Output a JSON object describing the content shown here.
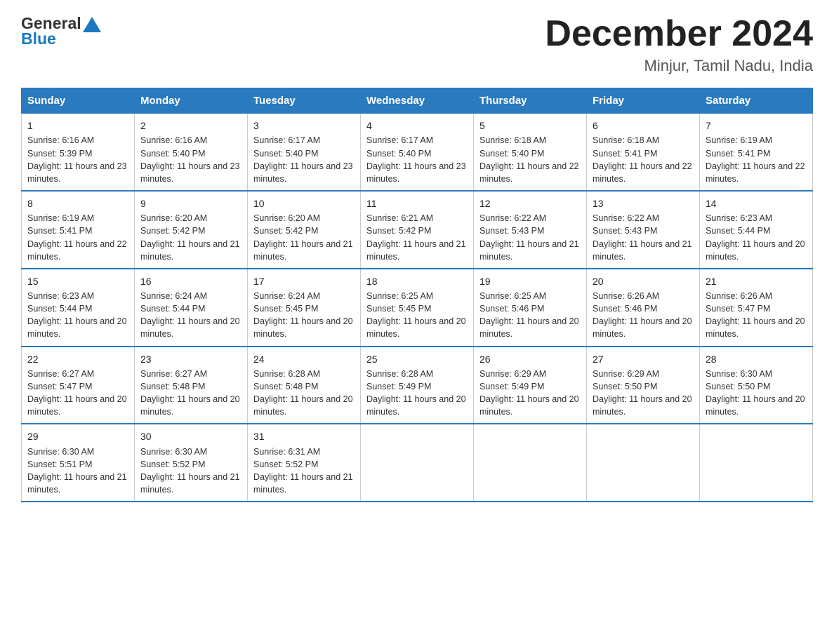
{
  "logo": {
    "text1": "General",
    "text2": "Blue"
  },
  "title": "December 2024",
  "location": "Minjur, Tamil Nadu, India",
  "days_of_week": [
    "Sunday",
    "Monday",
    "Tuesday",
    "Wednesday",
    "Thursday",
    "Friday",
    "Saturday"
  ],
  "weeks": [
    [
      {
        "day": "1",
        "sunrise": "6:16 AM",
        "sunset": "5:39 PM",
        "daylight": "11 hours and 23 minutes."
      },
      {
        "day": "2",
        "sunrise": "6:16 AM",
        "sunset": "5:40 PM",
        "daylight": "11 hours and 23 minutes."
      },
      {
        "day": "3",
        "sunrise": "6:17 AM",
        "sunset": "5:40 PM",
        "daylight": "11 hours and 23 minutes."
      },
      {
        "day": "4",
        "sunrise": "6:17 AM",
        "sunset": "5:40 PM",
        "daylight": "11 hours and 23 minutes."
      },
      {
        "day": "5",
        "sunrise": "6:18 AM",
        "sunset": "5:40 PM",
        "daylight": "11 hours and 22 minutes."
      },
      {
        "day": "6",
        "sunrise": "6:18 AM",
        "sunset": "5:41 PM",
        "daylight": "11 hours and 22 minutes."
      },
      {
        "day": "7",
        "sunrise": "6:19 AM",
        "sunset": "5:41 PM",
        "daylight": "11 hours and 22 minutes."
      }
    ],
    [
      {
        "day": "8",
        "sunrise": "6:19 AM",
        "sunset": "5:41 PM",
        "daylight": "11 hours and 22 minutes."
      },
      {
        "day": "9",
        "sunrise": "6:20 AM",
        "sunset": "5:42 PM",
        "daylight": "11 hours and 21 minutes."
      },
      {
        "day": "10",
        "sunrise": "6:20 AM",
        "sunset": "5:42 PM",
        "daylight": "11 hours and 21 minutes."
      },
      {
        "day": "11",
        "sunrise": "6:21 AM",
        "sunset": "5:42 PM",
        "daylight": "11 hours and 21 minutes."
      },
      {
        "day": "12",
        "sunrise": "6:22 AM",
        "sunset": "5:43 PM",
        "daylight": "11 hours and 21 minutes."
      },
      {
        "day": "13",
        "sunrise": "6:22 AM",
        "sunset": "5:43 PM",
        "daylight": "11 hours and 21 minutes."
      },
      {
        "day": "14",
        "sunrise": "6:23 AM",
        "sunset": "5:44 PM",
        "daylight": "11 hours and 20 minutes."
      }
    ],
    [
      {
        "day": "15",
        "sunrise": "6:23 AM",
        "sunset": "5:44 PM",
        "daylight": "11 hours and 20 minutes."
      },
      {
        "day": "16",
        "sunrise": "6:24 AM",
        "sunset": "5:44 PM",
        "daylight": "11 hours and 20 minutes."
      },
      {
        "day": "17",
        "sunrise": "6:24 AM",
        "sunset": "5:45 PM",
        "daylight": "11 hours and 20 minutes."
      },
      {
        "day": "18",
        "sunrise": "6:25 AM",
        "sunset": "5:45 PM",
        "daylight": "11 hours and 20 minutes."
      },
      {
        "day": "19",
        "sunrise": "6:25 AM",
        "sunset": "5:46 PM",
        "daylight": "11 hours and 20 minutes."
      },
      {
        "day": "20",
        "sunrise": "6:26 AM",
        "sunset": "5:46 PM",
        "daylight": "11 hours and 20 minutes."
      },
      {
        "day": "21",
        "sunrise": "6:26 AM",
        "sunset": "5:47 PM",
        "daylight": "11 hours and 20 minutes."
      }
    ],
    [
      {
        "day": "22",
        "sunrise": "6:27 AM",
        "sunset": "5:47 PM",
        "daylight": "11 hours and 20 minutes."
      },
      {
        "day": "23",
        "sunrise": "6:27 AM",
        "sunset": "5:48 PM",
        "daylight": "11 hours and 20 minutes."
      },
      {
        "day": "24",
        "sunrise": "6:28 AM",
        "sunset": "5:48 PM",
        "daylight": "11 hours and 20 minutes."
      },
      {
        "day": "25",
        "sunrise": "6:28 AM",
        "sunset": "5:49 PM",
        "daylight": "11 hours and 20 minutes."
      },
      {
        "day": "26",
        "sunrise": "6:29 AM",
        "sunset": "5:49 PM",
        "daylight": "11 hours and 20 minutes."
      },
      {
        "day": "27",
        "sunrise": "6:29 AM",
        "sunset": "5:50 PM",
        "daylight": "11 hours and 20 minutes."
      },
      {
        "day": "28",
        "sunrise": "6:30 AM",
        "sunset": "5:50 PM",
        "daylight": "11 hours and 20 minutes."
      }
    ],
    [
      {
        "day": "29",
        "sunrise": "6:30 AM",
        "sunset": "5:51 PM",
        "daylight": "11 hours and 21 minutes."
      },
      {
        "day": "30",
        "sunrise": "6:30 AM",
        "sunset": "5:52 PM",
        "daylight": "11 hours and 21 minutes."
      },
      {
        "day": "31",
        "sunrise": "6:31 AM",
        "sunset": "5:52 PM",
        "daylight": "11 hours and 21 minutes."
      },
      null,
      null,
      null,
      null
    ]
  ]
}
